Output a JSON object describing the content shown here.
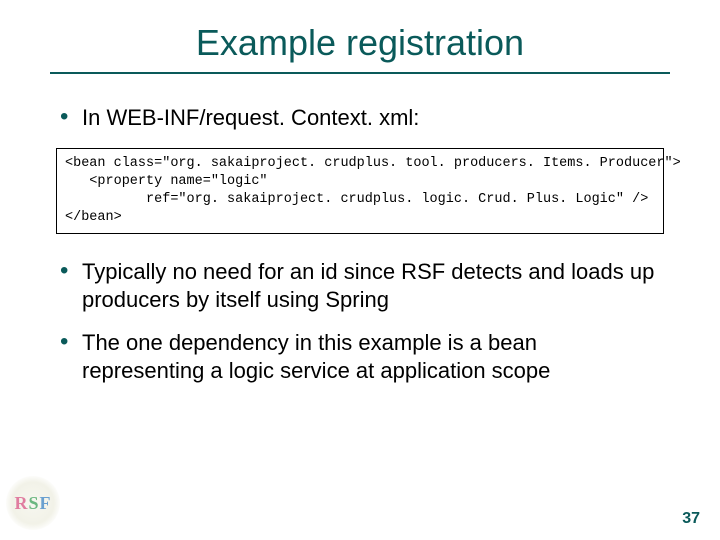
{
  "title": "Example registration",
  "bullets": {
    "intro": "In WEB-INF/request. Context. xml:",
    "point1": "Typically no need for an id since RSF detects and loads up producers by itself using Spring",
    "point2": "The one dependency in this example is a bean representing a logic service at application scope"
  },
  "code": "<bean class=\"org. sakaiproject. crudplus. tool. producers. Items. Producer\">\n   <property name=\"logic\"\n          ref=\"org. sakaiproject. crudplus. logic. Crud. Plus. Logic\" />\n</bean>",
  "logo": {
    "r": "R",
    "s": "S",
    "f": "F"
  },
  "page_number": "37"
}
